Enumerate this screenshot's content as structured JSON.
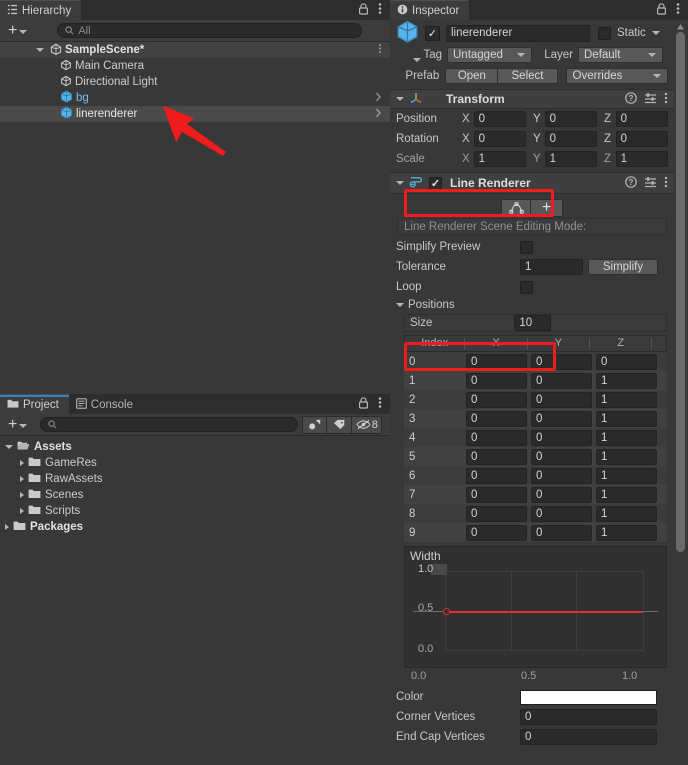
{
  "app": "Unity Editor",
  "hierarchy": {
    "tab_label": "Hierarchy",
    "lock_icon": "lock-icon",
    "menu_icon": "kebab-menu-icon",
    "add_label": "+",
    "search": {
      "value": "",
      "placeholder": "All",
      "icon": "search-icon"
    },
    "scene": {
      "label": "SampleScene*",
      "icon": "scene-icon",
      "expanded": true
    },
    "items": [
      {
        "label": "Main Camera",
        "icon": "gameobject-icon",
        "style": "plain",
        "expandable": false
      },
      {
        "label": "Directional Light",
        "icon": "gameobject-icon",
        "style": "plain",
        "expandable": false
      },
      {
        "label": "bg",
        "icon": "prefab-gameobject-icon",
        "style": "prefab",
        "expandable": true
      },
      {
        "label": "linerenderer",
        "icon": "prefab-gameobject-icon",
        "style": "selected",
        "expandable": true
      }
    ]
  },
  "project": {
    "tabs": [
      {
        "label": "Project",
        "icon": "folder-icon",
        "active": true
      },
      {
        "label": "Console",
        "icon": "console-icon",
        "active": false
      }
    ],
    "lock_icon": "lock-icon",
    "menu_icon": "kebab-menu-icon",
    "add_label": "+",
    "search": {
      "value": "",
      "placeholder": "",
      "icon": "search-icon"
    },
    "toolbar_icons": [
      "asset-filter-icon",
      "label-filter-icon",
      "visibility-icon"
    ],
    "visibility_count": "8",
    "tree": [
      {
        "label": "Assets",
        "depth": 0,
        "expanded": true,
        "bold": true
      },
      {
        "label": "GameRes",
        "depth": 1,
        "expanded": false,
        "bold": false
      },
      {
        "label": "RawAssets",
        "depth": 1,
        "expanded": false,
        "bold": false
      },
      {
        "label": "Scenes",
        "depth": 1,
        "expanded": false,
        "bold": false
      },
      {
        "label": "Scripts",
        "depth": 1,
        "expanded": false,
        "bold": false
      },
      {
        "label": "Packages",
        "depth": 0,
        "expanded": false,
        "bold": true
      }
    ]
  },
  "inspector": {
    "tab_label": "Inspector",
    "tab_icon": "info-icon",
    "lock_icon": "lock-icon",
    "menu_icon": "kebab-menu-icon",
    "gameobject": {
      "icon": "prefab-gameobject-icon",
      "enabled": true,
      "name": "linerenderer",
      "static_checked": false,
      "static_label": "Static",
      "tag_label": "Tag",
      "tag_value": "Untagged",
      "layer_label": "Layer",
      "layer_value": "Default",
      "prefab_label": "Prefab",
      "prefab_open": "Open",
      "prefab_select": "Select",
      "prefab_overrides": "Overrides"
    },
    "transform": {
      "title": "Transform",
      "icon": "transform-icon",
      "help_icon": "help-icon",
      "preset_icon": "preset-icon",
      "menu_icon": "kebab-menu-icon",
      "rows": [
        {
          "label": "Position",
          "dim": false,
          "x": "0",
          "y": "0",
          "z": "0"
        },
        {
          "label": "Rotation",
          "dim": false,
          "x": "0",
          "y": "0",
          "z": "0"
        },
        {
          "label": "Scale",
          "dim": true,
          "x": "1",
          "y": "1",
          "z": "1"
        }
      ],
      "axes": [
        "X",
        "Y",
        "Z"
      ]
    },
    "line_renderer": {
      "title": "Line Renderer",
      "icon": "line-renderer-icon",
      "enabled": true,
      "help_icon": "help-icon",
      "preset_icon": "preset-icon",
      "menu_icon": "kebab-menu-icon",
      "edit_points_icon": "edit-points-icon",
      "create_points_icon": "plus-icon",
      "scene_edit_mode_label": "Line Renderer Scene Editing Mode:",
      "simplify_preview_label": "Simplify Preview",
      "simplify_preview_checked": false,
      "tolerance_label": "Tolerance",
      "tolerance_value": "1",
      "simplify_button": "Simplify",
      "loop_label": "Loop",
      "loop_checked": false,
      "positions_label": "Positions",
      "size_label": "Size",
      "size_value": "10",
      "table_headers": [
        "Index",
        "X",
        "Y",
        "Z"
      ],
      "rows": [
        {
          "index": "0",
          "x": "0",
          "y": "0",
          "z": "0"
        },
        {
          "index": "1",
          "x": "0",
          "y": "0",
          "z": "1"
        },
        {
          "index": "2",
          "x": "0",
          "y": "0",
          "z": "1"
        },
        {
          "index": "3",
          "x": "0",
          "y": "0",
          "z": "1"
        },
        {
          "index": "4",
          "x": "0",
          "y": "0",
          "z": "1"
        },
        {
          "index": "5",
          "x": "0",
          "y": "0",
          "z": "1"
        },
        {
          "index": "6",
          "x": "0",
          "y": "0",
          "z": "1"
        },
        {
          "index": "7",
          "x": "0",
          "y": "0",
          "z": "1"
        },
        {
          "index": "8",
          "x": "0",
          "y": "0",
          "z": "1"
        },
        {
          "index": "9",
          "x": "0",
          "y": "0",
          "z": "1"
        }
      ],
      "width_curve": {
        "title": "Width",
        "y_ticks": [
          "1.0",
          "0.5",
          "0.0"
        ],
        "x_ticks": [
          "0.0",
          "0.5",
          "1.0"
        ],
        "curve_color": "#e02b2b",
        "value": "0.5"
      },
      "color_label": "Color",
      "color_value": "#ffffff",
      "corner_vertices_label": "Corner Vertices",
      "corner_vertices_value": "0",
      "end_cap_vertices_label": "End Cap Vertices",
      "end_cap_vertices_value": "0"
    }
  },
  "annotations": {
    "arrow_color": "#ee1c1c",
    "boxes": [
      {
        "name": "line-renderer-header-highlight"
      },
      {
        "name": "positions-size-highlight"
      }
    ]
  },
  "theme": {
    "bg": "#383838",
    "panel_header": "#3c3c3c",
    "field_bg": "#2a2a2a",
    "selection": "#4a4a4a",
    "prefab_blue": "#77baf0",
    "accent": "#3c7fb1"
  }
}
